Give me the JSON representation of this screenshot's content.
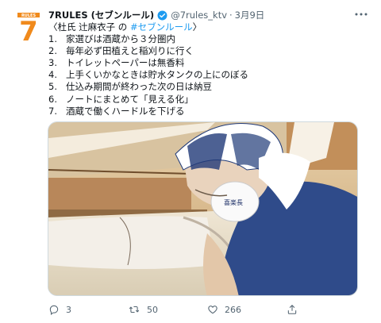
{
  "tweet": {
    "author_name": "7RULES (セブンルール)",
    "handle": "@7rules_ktv",
    "separator": "·",
    "date": "3月9日",
    "avatar_label": "RULES",
    "avatar_number": "7",
    "intro_prefix": "〈杜氏 辻麻衣子 の ",
    "hashtag": "#セブンルール",
    "intro_suffix": "〉",
    "rules": [
      {
        "num": "1.",
        "text": "家選びは酒蔵から３分圏内"
      },
      {
        "num": "2.",
        "text": "毎年必ず田植えと稲刈りに行く"
      },
      {
        "num": "3.",
        "text": "トイレットペーパーは無香料"
      },
      {
        "num": "4.",
        "text": "上手くいかなときは貯水タンクの上にのぼる"
      },
      {
        "num": "5.",
        "text": "仕込み期間が終わった次の日は納豆"
      },
      {
        "num": "6.",
        "text": "ノートにまとめて「見える化」"
      },
      {
        "num": "7.",
        "text": "酒蔵で働くハードルを下げる"
      }
    ],
    "mask_text": "喜楽長",
    "stats": {
      "replies": "3",
      "retweets": "50",
      "likes": "266"
    }
  },
  "colors": {
    "brand_orange": "#f08a1c",
    "verified_blue": "#1d9bf0",
    "hashtag_blue": "#1d9bf0",
    "muted_text": "#536471"
  },
  "icons": {
    "more": "more-icon",
    "verified": "verified-badge-icon",
    "reply": "reply-icon",
    "retweet": "retweet-icon",
    "like": "like-icon",
    "share": "share-icon"
  }
}
